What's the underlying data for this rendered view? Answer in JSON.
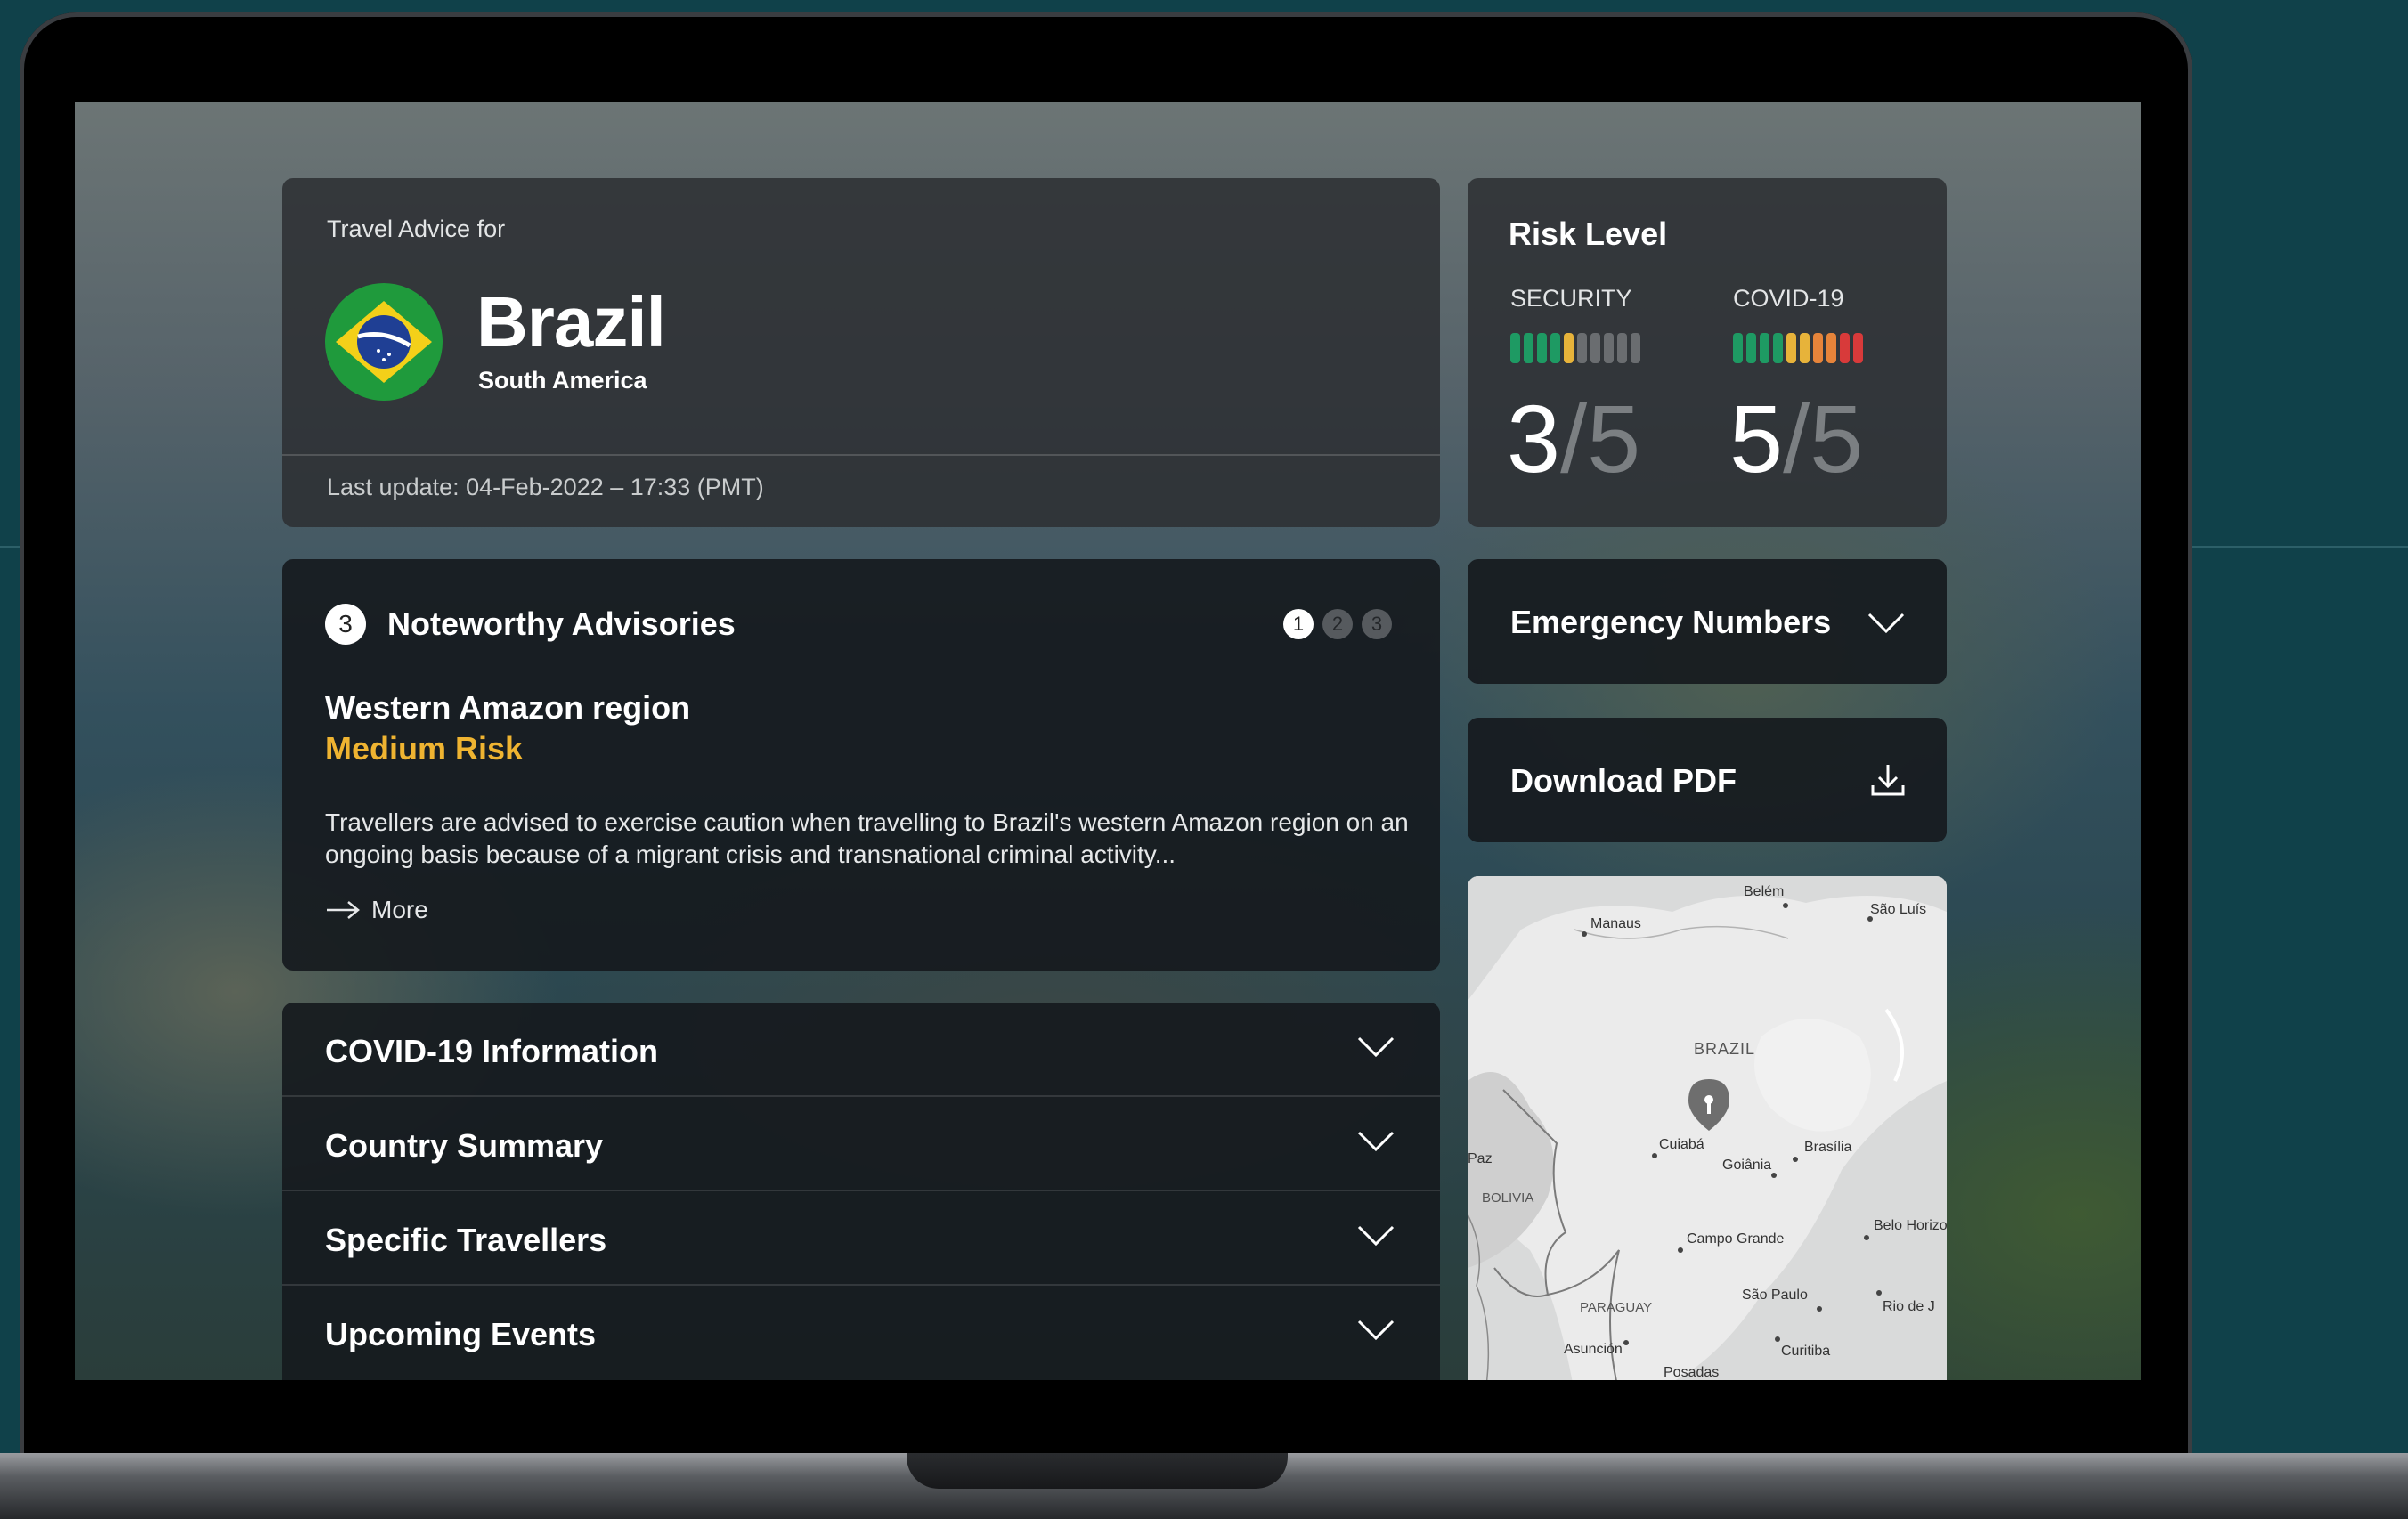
{
  "header": {
    "travel_advice_label": "Travel Advice for",
    "country": "Brazil",
    "region": "South America",
    "last_update": "Last update: 04-Feb-2022 – 17:33 (PMT)"
  },
  "risk": {
    "title": "Risk Level",
    "security": {
      "label": "SECURITY",
      "score": "3",
      "max": "/5",
      "bars_lit": 5,
      "bars_total": 10
    },
    "covid": {
      "label": "COVID-19",
      "score": "5",
      "max": "/5",
      "bars_lit": 10,
      "bars_total": 10
    }
  },
  "advisories": {
    "count": "3",
    "title": "Noteworthy Advisories",
    "pages": [
      "1",
      "2",
      "3"
    ],
    "active_page": 1,
    "region": "Western Amazon region",
    "risk": "Medium Risk",
    "text": "Travellers are advised to exercise caution when travelling to Brazil's western Amazon region on an ongoing basis because of a migrant crisis and transnational criminal activity...",
    "more_label": "More"
  },
  "accordions": [
    {
      "label": "COVID-19 Information"
    },
    {
      "label": "Country Summary"
    },
    {
      "label": "Specific Travellers"
    },
    {
      "label": "Upcoming Events"
    }
  ],
  "side": {
    "emergency_label": "Emergency Numbers",
    "download_label": "Download PDF"
  },
  "map": {
    "country_label": "BRAZIL",
    "cities": [
      "Manaus",
      "Belém",
      "São Luís",
      "Cuiabá",
      "Goiânia",
      "Brasília",
      "Campo Grande",
      "Belo Horizo",
      "São Paulo",
      "Rio de J",
      "Curitiba",
      "Asunción",
      "Posadas",
      "Paz"
    ],
    "countries": [
      "BOLIVIA",
      "PARAGUAY"
    ]
  },
  "colors": {
    "risk_green": "#1e9a63",
    "risk_yellow": "#e7b33a",
    "risk_orange": "#e6843a",
    "risk_red": "#d83a3a",
    "risk_off": "#6a6d70",
    "accent_medium_risk": "#efb431"
  }
}
